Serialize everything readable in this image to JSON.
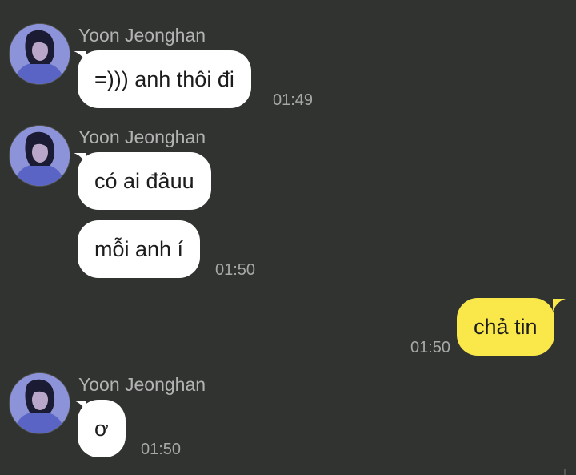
{
  "chat": {
    "colors": {
      "background": "#313331",
      "incoming_bubble": "#ffffff",
      "outgoing_bubble": "#fae84a",
      "sender_text": "#b3b3b3",
      "time_text": "#a8a8a8"
    },
    "groups": [
      {
        "sender": "Yoon Jeonghan",
        "avatar": "profile-photo",
        "messages": [
          {
            "text": "=))) anh thôi đi",
            "time": "01:49"
          }
        ]
      },
      {
        "sender": "Yoon Jeonghan",
        "avatar": "profile-photo",
        "messages": [
          {
            "text": "có ai đâuu",
            "time": ""
          },
          {
            "text": "mỗi anh í",
            "time": "01:50"
          }
        ]
      },
      {
        "direction": "outgoing",
        "messages": [
          {
            "text": "chả tin",
            "time": "01:50"
          }
        ]
      },
      {
        "sender": "Yoon Jeonghan",
        "avatar": "profile-photo",
        "messages": [
          {
            "text": "ơ",
            "time": "01:50"
          }
        ]
      }
    ]
  }
}
